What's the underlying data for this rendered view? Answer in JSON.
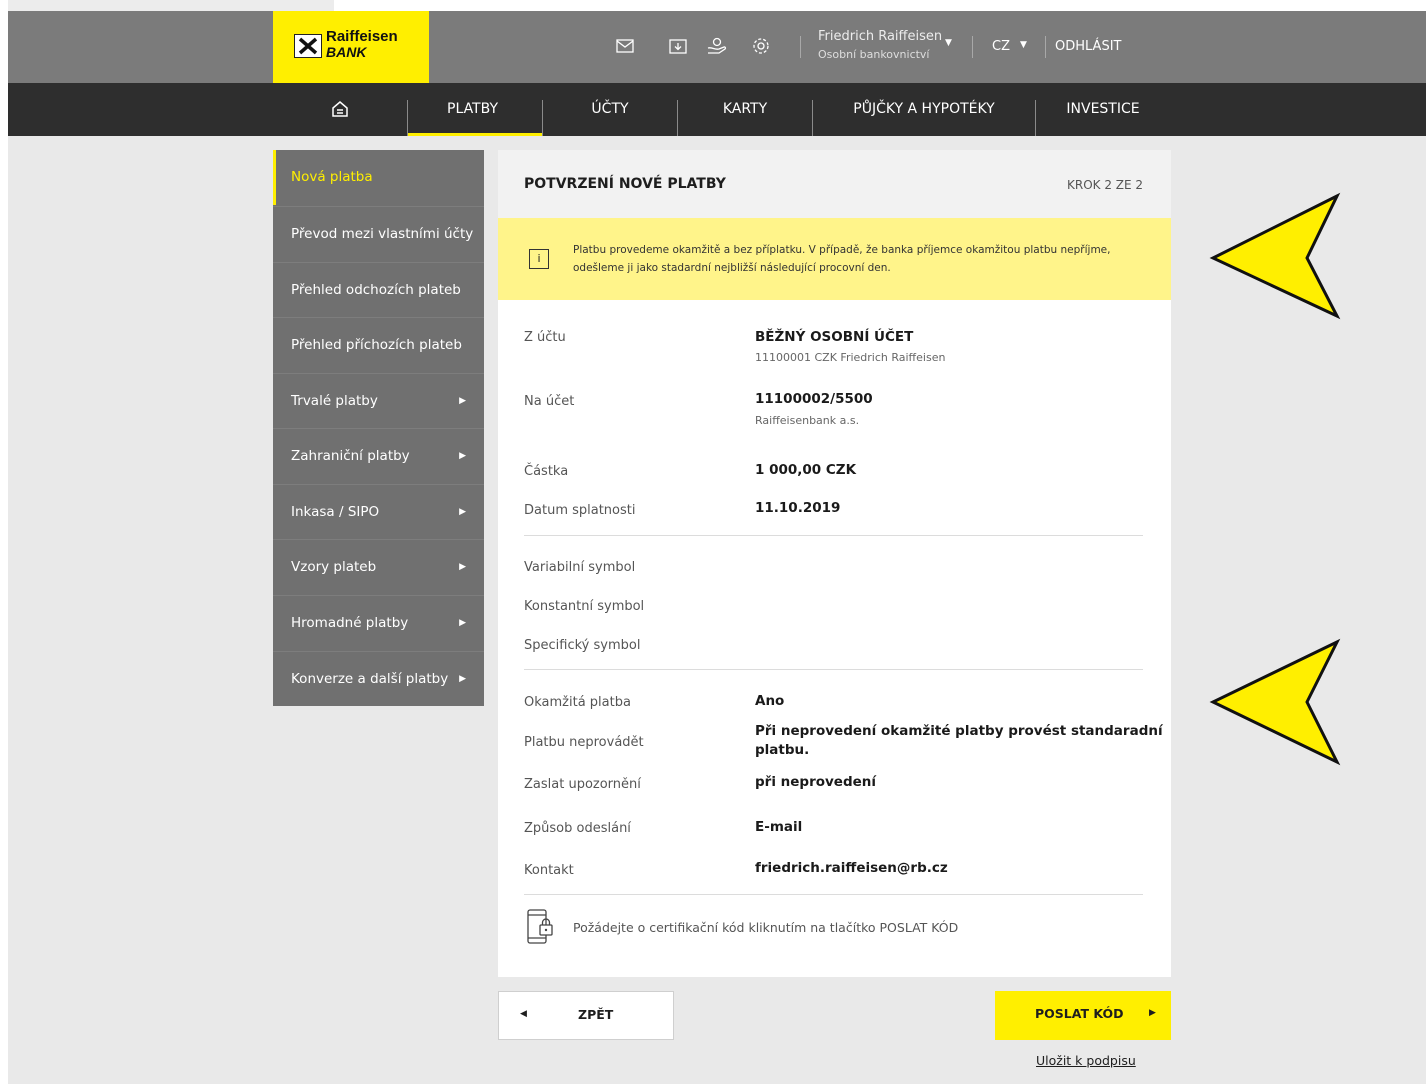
{
  "brand": {
    "name_line1": "Raiffeisen",
    "name_line2": "BANK",
    "color_yellow": "#ffef00"
  },
  "header": {
    "icons": [
      "mail-icon",
      "download-box-icon",
      "hand-money-icon",
      "settings-icon"
    ],
    "user_name": "Friedrich Raiffeisen",
    "user_sub": "Osobní bankovnictví",
    "language": "CZ",
    "logout": "ODHLÁSIT"
  },
  "nav": {
    "home_icon": "home-icon",
    "items": [
      "PLATBY",
      "ÚČTY",
      "KARTY",
      "PŮJČKY A HYPOTÉKY",
      "INVESTICE"
    ],
    "active": "PLATBY"
  },
  "sidebar": {
    "items": [
      {
        "label": "Nová platba",
        "active": true,
        "arrow": false
      },
      {
        "label": "Převod mezi vlastními účty",
        "arrow": false
      },
      {
        "label": "Přehled odchozích plateb",
        "arrow": false
      },
      {
        "label": "Přehled příchozích plateb",
        "arrow": false
      },
      {
        "label": "Trvalé platby",
        "arrow": true
      },
      {
        "label": "Zahraniční platby",
        "arrow": true
      },
      {
        "label": "Inkasa / SIPO",
        "arrow": true
      },
      {
        "label": "Vzory plateb",
        "arrow": true
      },
      {
        "label": "Hromadné platby",
        "arrow": true
      },
      {
        "label": "Konverze a další platby",
        "arrow": true
      }
    ]
  },
  "panel": {
    "title": "POTVRZENÍ NOVÉ PLATBY",
    "step": "KROK 2 ZE 2",
    "info_icon": "i",
    "info_text_line1": "Platbu provedeme okamžitě a bez příplatku. V případě, že banka příjemce okamžitou platbu nepříjme,",
    "info_text_line2": "odešleme ji jako stadardní nejbližší následující procovní den.",
    "from_label": "Z účtu",
    "from_value": "BĚŽNÝ OSOBNÍ ÚČET",
    "from_sub": "11100001  CZK Friedrich Raiffeisen",
    "to_label": "Na účet",
    "to_value": "11100002/5500",
    "to_sub": "Raiffeisenbank a.s.",
    "amount_label": "Částka",
    "amount_value": "1 000,00 CZK",
    "due_label": "Datum splatnosti",
    "due_value": "11.10.2019",
    "vs_label": "Variabilní symbol",
    "ks_label": "Konstantní symbol",
    "ss_label": "Specifický symbol",
    "instant_label": "Okamžitá platba",
    "instant_value": "Ano",
    "dont_label": "Platbu neprovádět",
    "dont_value_line1": "Při neprovedení okamžité platby provést standaradní",
    "dont_value_line2": "platbu.",
    "notify_label": "Zaslat upozornění",
    "notify_value": "při neprovedení",
    "method_label": "Způsob odeslání",
    "method_value": "E-mail",
    "contact_label": "Kontakt",
    "contact_value": "friedrich.raiffeisen@rb.cz",
    "cert_text": "Požádejte o certifikační kód kliknutím na tlačítko POSLAT KÓD"
  },
  "actions": {
    "back": "ZPĚT",
    "send": "POSLAT KÓD",
    "save": "Uložit k podpisu"
  }
}
